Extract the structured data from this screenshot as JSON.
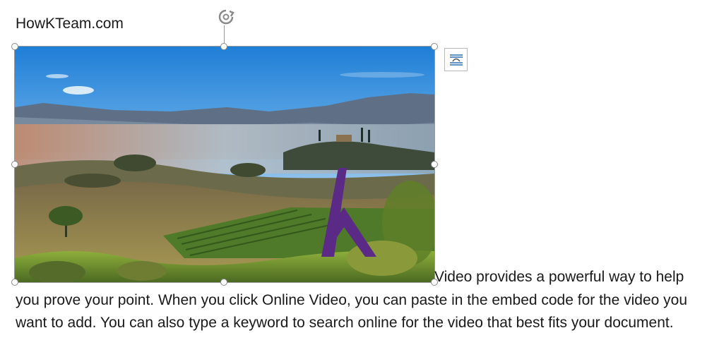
{
  "document": {
    "heading": "HowKTeam.com",
    "paragraph": "Video provides a powerful way to help you prove your point. When you click Online Video, you can paste in the embed code for the video you want to add. You can also type a keyword to search online for the video that best fits your document."
  },
  "picture": {
    "watermark_icon": "howkteam-k-logo",
    "logo_color": "#5b2a86"
  },
  "controls": {
    "rotate_icon": "rotate-handle-icon",
    "layout_options_icon": "layout-options-icon"
  }
}
